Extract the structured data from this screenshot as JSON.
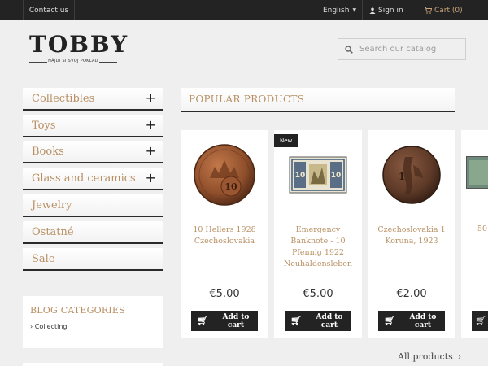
{
  "topbar": {
    "contact": "Contact us",
    "language": "English",
    "sign_in": "Sign in",
    "cart": "Cart (0)"
  },
  "header": {
    "logo_title": "TOBBY",
    "logo_tagline": "NÁJDI SI SVOJ POKLAD",
    "search_placeholder": "Search our catalog"
  },
  "sidebar": {
    "categories": [
      {
        "label": "Collectibles",
        "expandable": true
      },
      {
        "label": "Toys",
        "expandable": true
      },
      {
        "label": "Books",
        "expandable": true
      },
      {
        "label": "Glass and ceramics",
        "expandable": true
      },
      {
        "label": "Jewelry",
        "expandable": false
      },
      {
        "label": "Ostatné",
        "expandable": false
      },
      {
        "label": "Sale",
        "expandable": false
      }
    ],
    "blog": {
      "title": "BLOG CATEGORIES",
      "items": [
        "Collecting"
      ]
    }
  },
  "main": {
    "section_title": "POPULAR PRODUCTS",
    "products": [
      {
        "name": "10 Hellers 1928 Czechoslovakia",
        "price": "€5.00",
        "badge": "",
        "button": "Add to cart"
      },
      {
        "name": "Emergency Banknote - 10 Pfennig 1922 Neuhaldensleben",
        "price": "€5.00",
        "badge": "New",
        "button": "Add to cart"
      },
      {
        "name": "Czechoslovakia 1 Koruna, 1923",
        "price": "€2.00",
        "badge": "",
        "button": "Add to cart"
      },
      {
        "name": "50",
        "price": "",
        "badge": "",
        "button": ""
      }
    ],
    "all_products": "All products"
  },
  "colors": {
    "accent": "#b89064",
    "dark": "#232323",
    "background": "#efefef"
  }
}
